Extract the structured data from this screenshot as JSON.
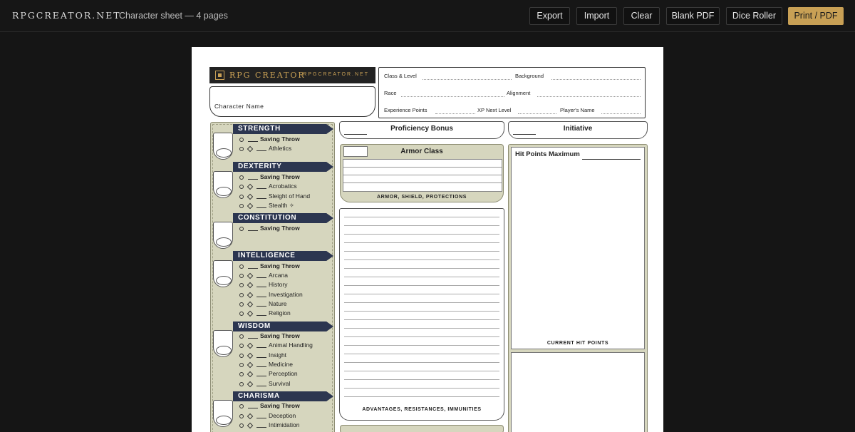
{
  "topbar": {
    "brand": "RPGCREATOR.NET",
    "subtitle": "Character sheet — 4 pages",
    "buttons": {
      "export": "Export",
      "import": "Import",
      "clear": "Clear",
      "blank_pdf": "Blank PDF",
      "dice_roller": "Dice Roller",
      "print_pdf": "Print / PDF"
    }
  },
  "sheet": {
    "logo": {
      "text": "RPG CREATOR",
      "url": "RPGCREATOR.NET"
    },
    "character_name_label": "Character Name",
    "info": {
      "class_level": "Class & Level",
      "background": "Background",
      "race": "Race",
      "alignment": "Alignment",
      "experience_points": "Experience Points",
      "xp_next_level": "XP Next Level",
      "players_name": "Player's Name"
    },
    "abilities": [
      {
        "name": "STRENGTH",
        "saving": "Saving Throw",
        "skills": [
          "Athletics"
        ]
      },
      {
        "name": "DEXTERITY",
        "saving": "Saving Throw",
        "skills": [
          "Acrobatics",
          "Sleight of Hand",
          "Stealth ✧"
        ]
      },
      {
        "name": "CONSTITUTION",
        "saving": "Saving Throw",
        "skills": []
      },
      {
        "name": "INTELLIGENCE",
        "saving": "Saving Throw",
        "skills": [
          "Arcana",
          "History",
          "Investigation",
          "Nature",
          "Religion"
        ]
      },
      {
        "name": "WISDOM",
        "saving": "Saving Throw",
        "skills": [
          "Animal Handling",
          "Insight",
          "Medicine",
          "Perception",
          "Survival"
        ]
      },
      {
        "name": "CHARISMA",
        "saving": "Saving Throw",
        "skills": [
          "Deception",
          "Intimidation"
        ]
      }
    ],
    "proficiency_bonus": "Proficiency Bonus",
    "initiative": "Initiative",
    "armor_class": "Armor Class",
    "armor_caption": "ARMOR, SHIELD, PROTECTIONS",
    "advantages_caption": "ADVANTAGES, RESISTANCES, IMMUNITIES",
    "hit_points_maximum": "Hit Points Maximum",
    "current_hit_points": "CURRENT HIT POINTS"
  }
}
